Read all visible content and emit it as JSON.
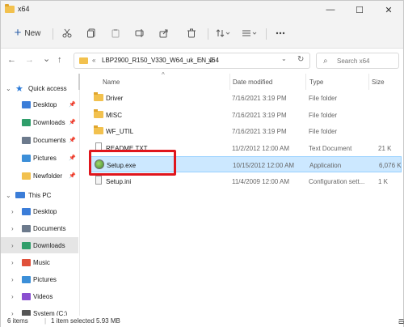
{
  "window": {
    "title": "x64",
    "minimize": "—",
    "maximize": "☐",
    "close": "✕"
  },
  "toolbar": {
    "new_label": "New",
    "new_plus": "+",
    "icons": [
      "cut-icon",
      "copy-icon",
      "paste-icon",
      "rename-icon",
      "share-icon",
      "delete-icon",
      "sort-icon",
      "view-icon",
      "more-icon"
    ]
  },
  "address": {
    "back": "←",
    "forward": "→",
    "dropdown": "⌄",
    "up": "↑",
    "crumb_prefix": "«",
    "crumb_1": "LBP2900_R150_V330_W64_uk_EN_2",
    "crumb_sep": "›",
    "crumb_2": "x64",
    "dropdown_arrow": "⌄",
    "refresh": "↻",
    "search_placeholder": "Search x64",
    "search_glyph": "⌕"
  },
  "sidebar": {
    "quick_access": "Quick access",
    "items_quick": [
      {
        "label": "Desktop",
        "color": "#3b7dd8"
      },
      {
        "label": "Downloads",
        "color": "#2f9e6a"
      },
      {
        "label": "Documents",
        "color": "#6c7a8c"
      },
      {
        "label": "Pictures",
        "color": "#3c8fd8"
      },
      {
        "label": "Newfolder",
        "color": "#f2c14e"
      }
    ],
    "this_pc": "This PC",
    "items_pc": [
      {
        "label": "Desktop",
        "color": "#3b7dd8"
      },
      {
        "label": "Documents",
        "color": "#6c7a8c"
      },
      {
        "label": "Downloads",
        "color": "#2f9e6a"
      },
      {
        "label": "Music",
        "color": "#e0503a"
      },
      {
        "label": "Pictures",
        "color": "#3c8fd8"
      },
      {
        "label": "Videos",
        "color": "#8a4fd0"
      },
      {
        "label": "System (C:)",
        "color": "#555555"
      }
    ]
  },
  "columns": {
    "name": "Name",
    "date": "Date modified",
    "type": "Type",
    "size": "Size"
  },
  "files": [
    {
      "name": "Driver",
      "date": "7/16/2021 3:19 PM",
      "type": "File folder",
      "size": "",
      "icon": "folder"
    },
    {
      "name": "MISC",
      "date": "7/16/2021 3:19 PM",
      "type": "File folder",
      "size": "",
      "icon": "folder"
    },
    {
      "name": "WF_UTIL",
      "date": "7/16/2021 3:19 PM",
      "type": "File folder",
      "size": "",
      "icon": "folder"
    },
    {
      "name": "README.TXT",
      "date": "11/2/2012 12:00 AM",
      "type": "Text Document",
      "size": "21 K",
      "icon": "doc"
    },
    {
      "name": "Setup.exe",
      "date": "10/15/2012 12:00 AM",
      "type": "Application",
      "size": "6,076 K",
      "icon": "exe"
    },
    {
      "name": "Setup.ini",
      "date": "11/4/2009 12:00 AM",
      "type": "Configuration sett...",
      "size": "1 K",
      "icon": "ini"
    }
  ],
  "status": {
    "items": "6 items",
    "selected": "1 item selected  5.93 MB"
  },
  "colors": {
    "selection": "#cce8ff",
    "highlight_box": "#e0161d",
    "folder": "#f2c14e"
  }
}
